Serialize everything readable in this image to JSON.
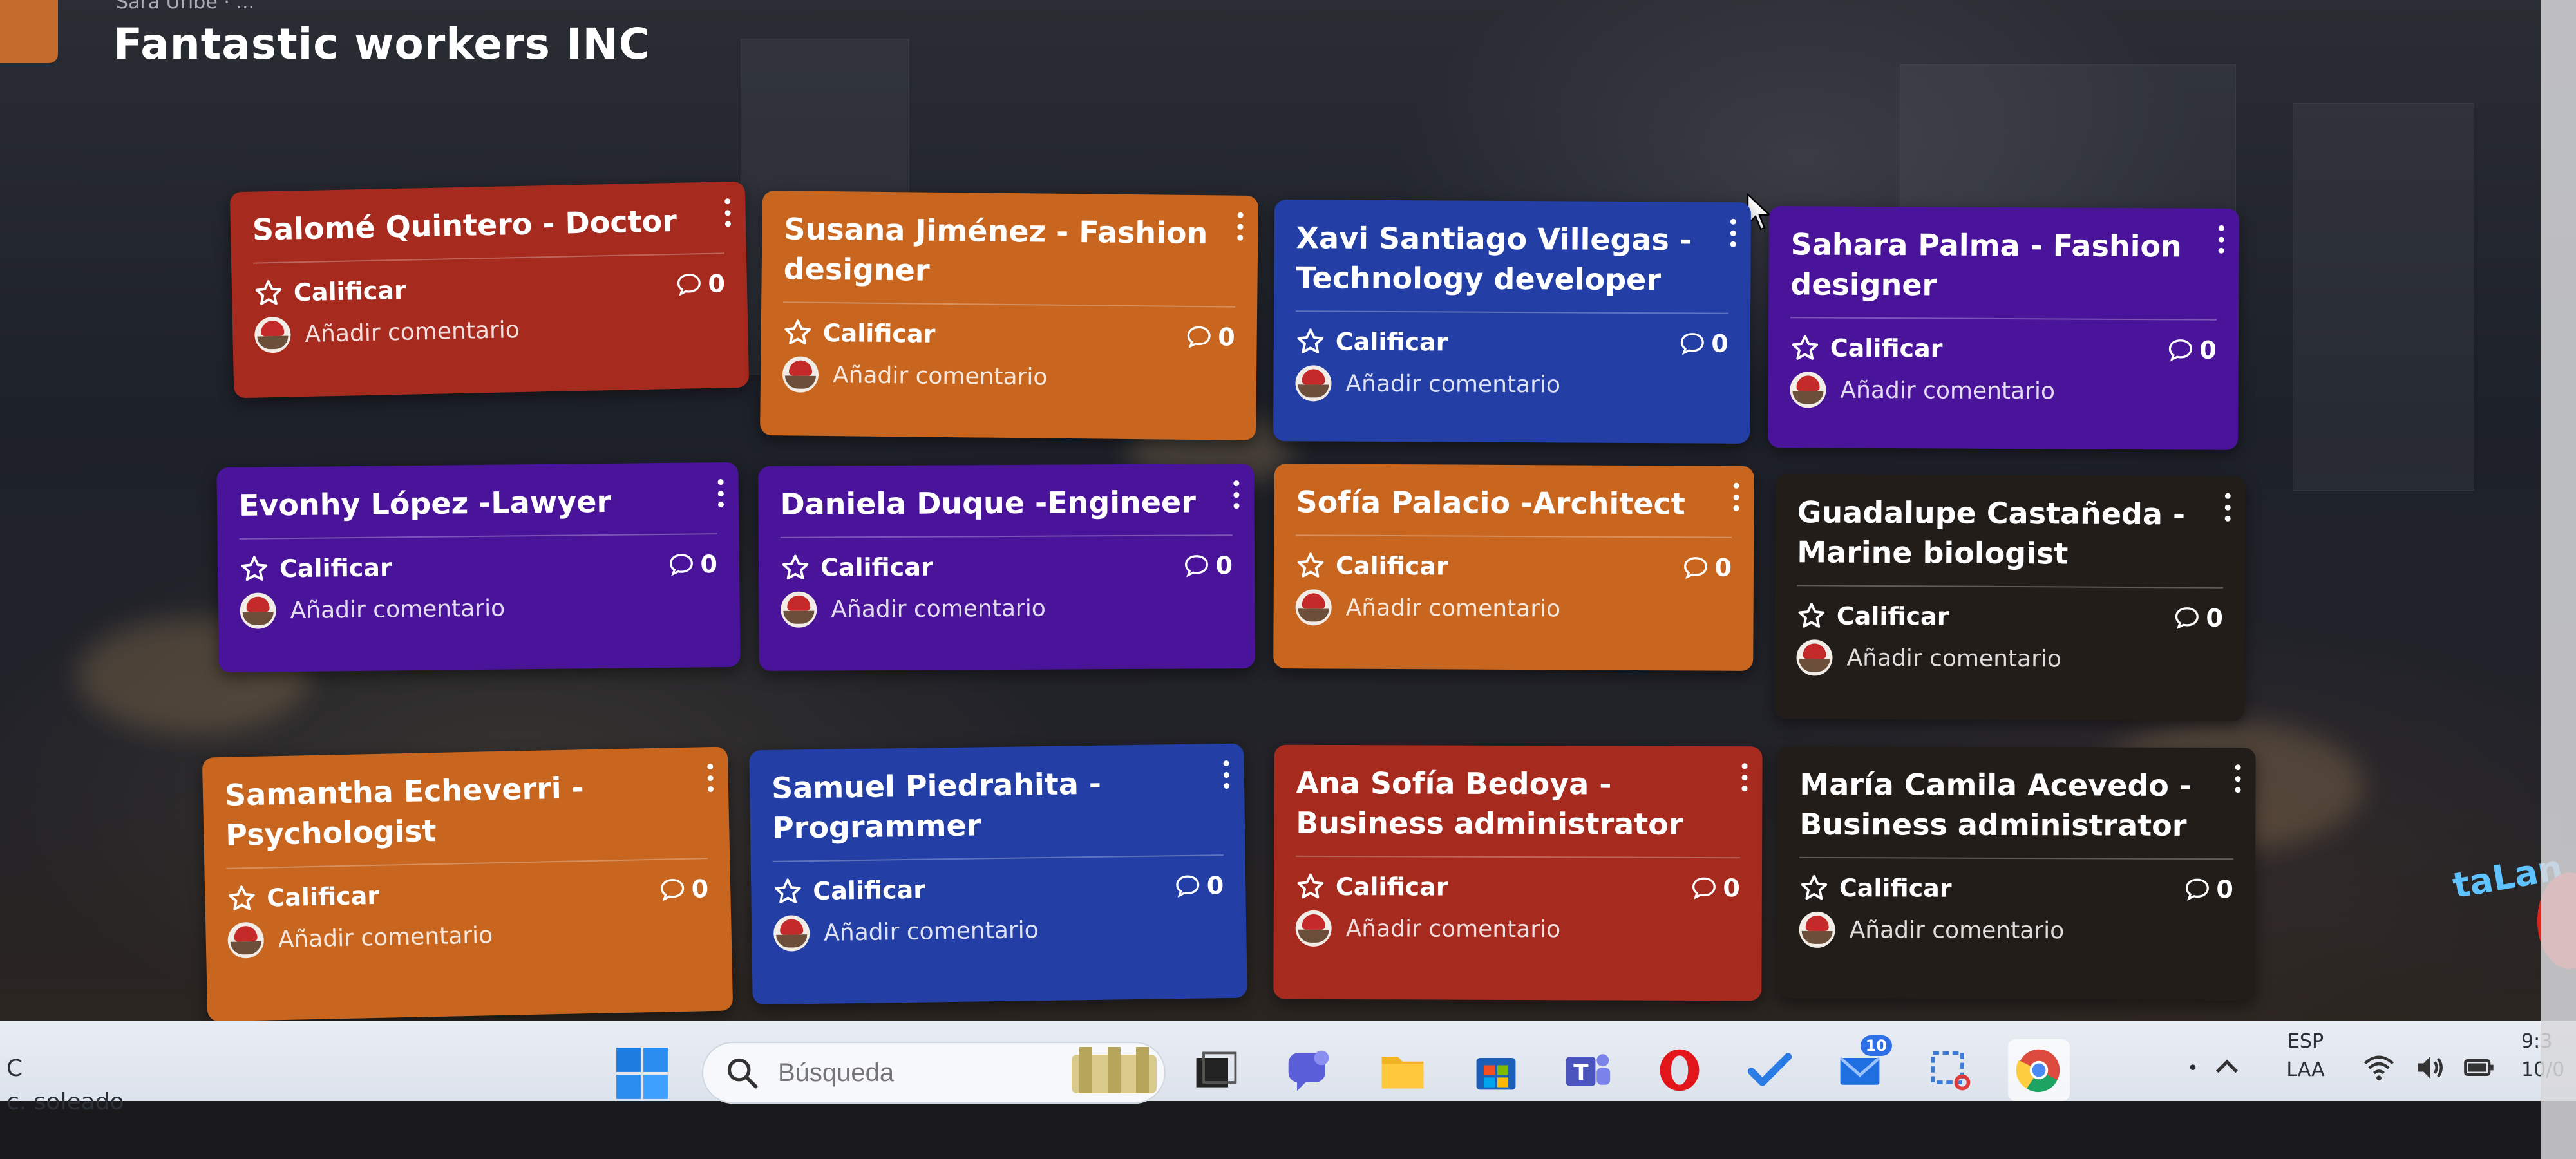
{
  "board": {
    "owner": "Sara Uribe · ...",
    "title": "Fantastic workers INC"
  },
  "cards": [
    {
      "title": "Salomé Quintero - Doctor",
      "color": "#a62a1e",
      "rate_label": "Calificar",
      "comments": "0",
      "comment_label": "Añadir comentario"
    },
    {
      "title": "Susana Jiménez - Fashion designer",
      "color": "#c8651f",
      "rate_label": "Calificar",
      "comments": "0",
      "comment_label": "Añadir comentario"
    },
    {
      "title": "Xavi Santiago Villegas - Technology developer",
      "color": "#233fa5",
      "rate_label": "Calificar",
      "comments": "0",
      "comment_label": "Añadir comentario"
    },
    {
      "title": "Sahara Palma - Fashion designer",
      "color": "#4a149a",
      "rate_label": "Calificar",
      "comments": "0",
      "comment_label": "Añadir comentario"
    },
    {
      "title": "Evonhy López -Lawyer",
      "color": "#4a149a",
      "rate_label": "Calificar",
      "comments": "0",
      "comment_label": "Añadir comentario"
    },
    {
      "title": "Daniela Duque -Engineer",
      "color": "#4a149a",
      "rate_label": "Calificar",
      "comments": "0",
      "comment_label": "Añadir comentario"
    },
    {
      "title": "Sofía Palacio -Architect",
      "color": "#c8651f",
      "rate_label": "Calificar",
      "comments": "0",
      "comment_label": "Añadir comentario"
    },
    {
      "title": "Guadalupe Castañeda - Marine biologist",
      "color": "#221d19",
      "rate_label": "Calificar",
      "comments": "0",
      "comment_label": "Añadir comentario"
    },
    {
      "title": "Samantha Echeverri - Psychologist",
      "color": "#c8651f",
      "rate_label": "Calificar",
      "comments": "0",
      "comment_label": "Añadir comentario"
    },
    {
      "title": "Samuel Piedrahita - Programmer",
      "color": "#233fa5",
      "rate_label": "Calificar",
      "comments": "0",
      "comment_label": "Añadir comentario"
    },
    {
      "title": "Ana Sofía Bedoya - Business administrator",
      "color": "#a62a1e",
      "rate_label": "Calificar",
      "comments": "0",
      "comment_label": "Añadir comentario"
    },
    {
      "title": "María Camila Acevedo - Business administrator",
      "color": "#221d19",
      "rate_label": "Calificar",
      "comments": "0",
      "comment_label": "Añadir comentario"
    }
  ],
  "taskbar": {
    "weather_temp": "C",
    "weather_desc": "c. soleado",
    "search_placeholder": "Búsqueda",
    "mail_badge": "10",
    "lang_top": "ESP",
    "lang_bottom": "LAA",
    "time": "9:3",
    "date": "10/0"
  },
  "background_sign": "taLan"
}
